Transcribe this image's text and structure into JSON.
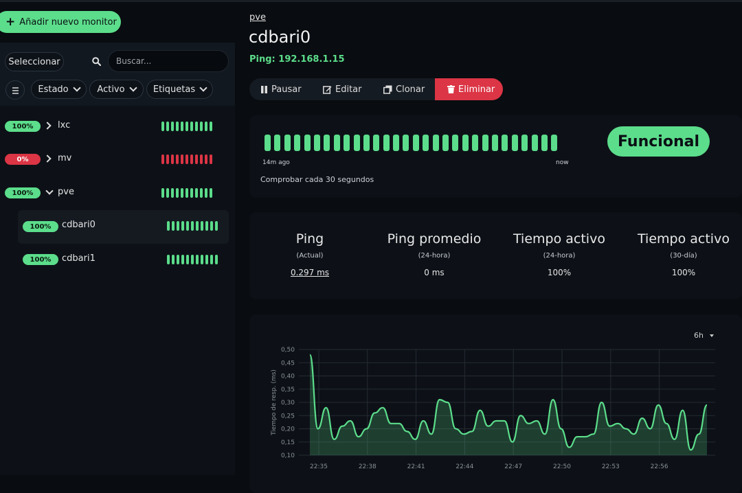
{
  "sidebar": {
    "add_label": "Añadir nuevo monitor",
    "select_label": "Seleccionar",
    "search_placeholder": "Buscar...",
    "filters": {
      "status": "Estado",
      "active": "Activo",
      "tags": "Etiquetas"
    },
    "monitors": [
      {
        "badge": "100%",
        "name": "lxc",
        "status": "up",
        "expanded": false
      },
      {
        "badge": "0%",
        "name": "mv",
        "status": "down",
        "expanded": false
      },
      {
        "badge": "100%",
        "name": "pve",
        "status": "up",
        "expanded": true
      },
      {
        "badge": "100%",
        "name": "cdbari0",
        "status": "up",
        "child": true,
        "selected": true
      },
      {
        "badge": "100%",
        "name": "cdbari1",
        "status": "up",
        "child": true
      }
    ]
  },
  "monitor": {
    "breadcrumb": "pve",
    "title": "cdbari0",
    "ping_target": "Ping: 192.168.1.15"
  },
  "toolbar": {
    "pause": "Pausar",
    "edit": "Editar",
    "clone": "Clonar",
    "delete": "Eliminar"
  },
  "heartbeat": {
    "start_label": "14m ago",
    "end_label": "now",
    "interval_text": "Comprobar cada 30 segundos",
    "status": "Funcional"
  },
  "stats": [
    {
      "title": "Ping",
      "sub": "(Actual)",
      "value": "0.297 ms"
    },
    {
      "title": "Ping promedio",
      "sub": "(24-hora)",
      "value": "0 ms"
    },
    {
      "title": "Tiempo activo",
      "sub": "(24-hora)",
      "value": "100%"
    },
    {
      "title": "Tiempo activo",
      "sub": "(30-día)",
      "value": "100%"
    }
  ],
  "chart_period": "6h",
  "colors": {
    "accent": "#5cdd8b",
    "danger": "#dc3545",
    "background": "#090c10"
  },
  "chart_data": {
    "type": "area",
    "ylabel": "Tiempo de resp. (ms)",
    "ylim": [
      0.1,
      0.5
    ],
    "yticks": [
      "0,10",
      "0,15",
      "0,20",
      "0,25",
      "0,30",
      "0,35",
      "0,40",
      "0,45",
      "0,50"
    ],
    "xticks": [
      "22:35",
      "22:38",
      "22:41",
      "22:44",
      "22:47",
      "22:50",
      "22:53",
      "22:56"
    ],
    "grid": true,
    "series": [
      {
        "values": [
          0.48,
          0.2,
          0.28,
          0.16,
          0.21,
          0.23,
          0.17,
          0.2,
          0.26,
          0.28,
          0.22,
          0.22,
          0.19,
          0.16,
          0.23,
          0.18,
          0.31,
          0.3,
          0.2,
          0.18,
          0.19,
          0.27,
          0.21,
          0.23,
          0.23,
          0.15,
          0.25,
          0.22,
          0.23,
          0.18,
          0.31,
          0.2,
          0.13,
          0.17,
          0.17,
          0.18,
          0.3,
          0.21,
          0.22,
          0.2,
          0.18,
          0.24,
          0.2,
          0.29,
          0.22,
          0.16,
          0.27,
          0.12,
          0.18,
          0.29
        ]
      }
    ]
  }
}
